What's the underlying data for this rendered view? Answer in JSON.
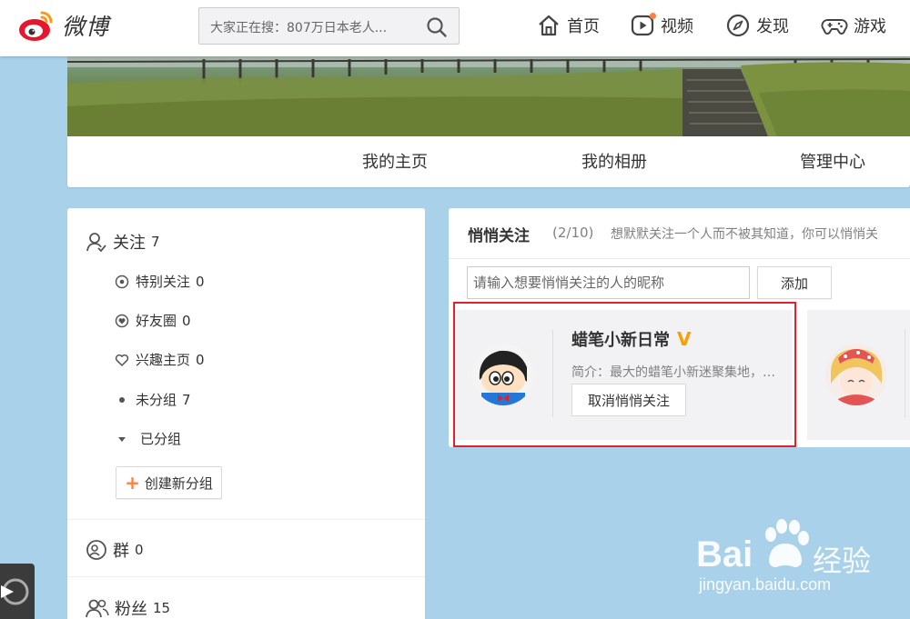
{
  "brand": {
    "name": "微博"
  },
  "search": {
    "text": "大家正在搜：807万日本老人..."
  },
  "nav": [
    {
      "label": "首页",
      "icon": "home-icon"
    },
    {
      "label": "视频",
      "icon": "video-icon"
    },
    {
      "label": "发现",
      "icon": "compass-icon"
    },
    {
      "label": "游戏",
      "icon": "gamepad-icon"
    }
  ],
  "profile_tabs": [
    "我的主页",
    "我的相册",
    "管理中心"
  ],
  "sidebar": {
    "follow": {
      "label": "关注",
      "count": "7"
    },
    "sub_items": [
      {
        "label": "特别关注",
        "count": "0",
        "icon": "target-icon"
      },
      {
        "label": "好友圈",
        "count": "0",
        "icon": "heart-circle-icon"
      },
      {
        "label": "兴趣主页",
        "count": "0",
        "icon": "heart-outline-icon"
      },
      {
        "label": "未分组",
        "count": "7",
        "icon": "dot-icon"
      },
      {
        "label": "已分组",
        "count": "",
        "icon": "triangle-down-icon"
      }
    ],
    "create_group": "创建新分组",
    "groups": {
      "label": "群",
      "count": "0"
    },
    "fans": {
      "label": "粉丝",
      "count": "15"
    }
  },
  "main": {
    "title": "悄悄关注",
    "count": "(2/10)",
    "desc": "想默默关注一个人而不被其知道，你可以悄悄关",
    "input_placeholder": "请输入想要悄悄关注的人的昵称",
    "add_label": "添加",
    "cards": [
      {
        "name": "蜡笔小新日常",
        "verified_mark": "V",
        "intro": "简介：最大的蜡笔小新迷聚集地，…",
        "button": "取消悄悄关注"
      }
    ]
  },
  "watermark": {
    "brand": "Bai",
    "brand_cn": "经验",
    "url": "jingyan.baidu.com"
  },
  "colors": {
    "accent": "#ff8140",
    "highlight": "#e5202a",
    "verified": "#f6a100",
    "page_bg": "#a9d1ea"
  }
}
